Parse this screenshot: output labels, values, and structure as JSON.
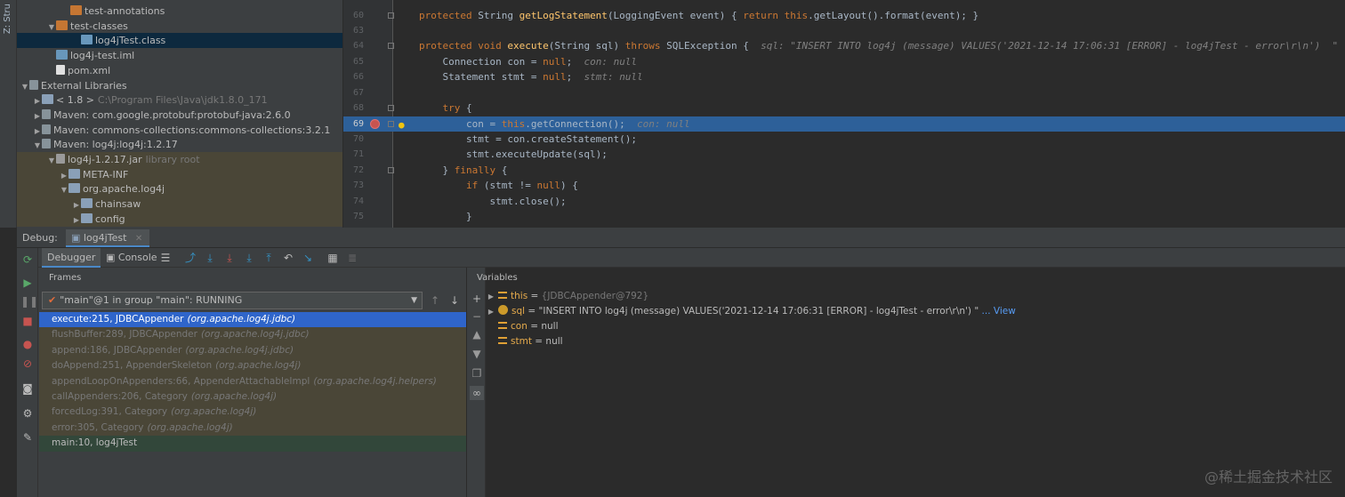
{
  "sidebar": {
    "strip_label": "Z: Stru"
  },
  "project_tree": [
    {
      "indent": 50,
      "arrow": "",
      "icon": "folder",
      "label": "test-annotations",
      "extra": ""
    },
    {
      "indent": 34,
      "arrow": "down",
      "icon": "folder",
      "label": "test-classes",
      "extra": ""
    },
    {
      "indent": 62,
      "arrow": "",
      "icon": "file",
      "label": "log4jTest.class",
      "extra": "",
      "selected": true
    },
    {
      "indent": 34,
      "arrow": "",
      "icon": "file",
      "label": "log4j-test.iml",
      "extra": ""
    },
    {
      "indent": 34,
      "arrow": "",
      "icon": "xml",
      "label": "pom.xml",
      "extra": ""
    },
    {
      "indent": 4,
      "arrow": "down",
      "icon": "lib",
      "label": "External Libraries",
      "extra": ""
    },
    {
      "indent": 18,
      "arrow": "right",
      "icon": "folder-blue",
      "label": "< 1.8 >",
      "extra": "C:\\Program Files\\Java\\jdk1.8.0_171"
    },
    {
      "indent": 18,
      "arrow": "right",
      "icon": "lib",
      "label": "Maven: com.google.protobuf:protobuf-java:2.6.0",
      "extra": ""
    },
    {
      "indent": 18,
      "arrow": "right",
      "icon": "lib",
      "label": "Maven: commons-collections:commons-collections:3.2.1",
      "extra": ""
    },
    {
      "indent": 18,
      "arrow": "down",
      "icon": "lib",
      "label": "Maven: log4j:log4j:1.2.17",
      "extra": ""
    },
    {
      "indent": 34,
      "arrow": "down",
      "icon": "jar",
      "label": "log4j-1.2.17.jar",
      "extra": "library root",
      "lib": true
    },
    {
      "indent": 48,
      "arrow": "right",
      "icon": "folder-blue",
      "label": "META-INF",
      "extra": "",
      "lib": true
    },
    {
      "indent": 48,
      "arrow": "down",
      "icon": "folder-blue",
      "label": "org.apache.log4j",
      "extra": "",
      "lib": true
    },
    {
      "indent": 62,
      "arrow": "right",
      "icon": "folder-blue",
      "label": "chainsaw",
      "extra": "",
      "lib": true
    },
    {
      "indent": 62,
      "arrow": "right",
      "icon": "folder-blue",
      "label": "config",
      "extra": "",
      "lib": true
    }
  ],
  "editor": {
    "lines": [
      {
        "num": "60",
        "segments": [
          [
            "kw",
            "protected "
          ],
          [
            "",
            "String "
          ],
          [
            "fn",
            "getLogStatement"
          ],
          [
            "",
            "(LoggingEvent event) { "
          ],
          [
            "kw",
            "return "
          ],
          [
            "kw",
            "this"
          ],
          [
            "",
            ".getLayout().format(event); }"
          ]
        ]
      },
      {
        "num": "63",
        "segments": []
      },
      {
        "num": "64",
        "segments": [
          [
            "kw",
            "protected void "
          ],
          [
            "fn",
            "execute"
          ],
          [
            "",
            "(String sql) "
          ],
          [
            "kw",
            "throws "
          ],
          [
            "",
            "SQLException {  "
          ],
          [
            "cm",
            "sql: \"INSERT INTO log4j (message) VALUES('2021-12-14 17:06:31 [ERROR] - log4jTest - error\\r\\n')  \""
          ]
        ]
      },
      {
        "num": "65",
        "segments": [
          [
            "",
            "    Connection con = "
          ],
          [
            "kw",
            "null"
          ],
          [
            "",
            ";  "
          ],
          [
            "cm",
            "con: null"
          ]
        ]
      },
      {
        "num": "66",
        "segments": [
          [
            "",
            "    Statement stmt = "
          ],
          [
            "kw",
            "null"
          ],
          [
            "",
            ";  "
          ],
          [
            "cm",
            "stmt: null"
          ]
        ]
      },
      {
        "num": "67",
        "segments": []
      },
      {
        "num": "68",
        "segments": [
          [
            "kw",
            "    try "
          ],
          [
            "",
            "{"
          ]
        ]
      },
      {
        "num": "69",
        "segments": [
          [
            "",
            "        con = "
          ],
          [
            "kw",
            "this"
          ],
          [
            "",
            ".getConnection();  "
          ],
          [
            "cm",
            "con: null"
          ]
        ],
        "highlight": true
      },
      {
        "num": "70",
        "segments": [
          [
            "",
            "        stmt = con.createStatement();"
          ]
        ]
      },
      {
        "num": "71",
        "segments": [
          [
            "",
            "        stmt.executeUpdate(sql);"
          ]
        ]
      },
      {
        "num": "72",
        "segments": [
          [
            "",
            "    } "
          ],
          [
            "kw",
            "finally "
          ],
          [
            "",
            "{"
          ]
        ]
      },
      {
        "num": "73",
        "segments": [
          [
            "kw",
            "        if "
          ],
          [
            "",
            "(stmt != "
          ],
          [
            "kw",
            "null"
          ],
          [
            "",
            ") {"
          ]
        ]
      },
      {
        "num": "74",
        "segments": [
          [
            "",
            "            stmt.close();"
          ]
        ]
      },
      {
        "num": "75",
        "segments": [
          [
            "",
            "        }"
          ]
        ]
      }
    ]
  },
  "debug": {
    "label": "Debug:",
    "tab": "log4jTest",
    "tabs": [
      "Debugger",
      "Console"
    ],
    "frames_title": "Frames",
    "thread": "\"main\"@1 in group \"main\": RUNNING",
    "frames": [
      {
        "method": "execute:215, JDBCAppender",
        "pkg": "(org.apache.log4j.jdbc)",
        "state": "sel"
      },
      {
        "method": "flushBuffer:289, JDBCAppender",
        "pkg": "(org.apache.log4j.jdbc)",
        "state": "lib"
      },
      {
        "method": "append:186, JDBCAppender",
        "pkg": "(org.apache.log4j.jdbc)",
        "state": "lib"
      },
      {
        "method": "doAppend:251, AppenderSkeleton",
        "pkg": "(org.apache.log4j)",
        "state": "lib"
      },
      {
        "method": "appendLoopOnAppenders:66, AppenderAttachableImpl",
        "pkg": "(org.apache.log4j.helpers)",
        "state": "lib"
      },
      {
        "method": "callAppenders:206, Category",
        "pkg": "(org.apache.log4j)",
        "state": "lib"
      },
      {
        "method": "forcedLog:391, Category",
        "pkg": "(org.apache.log4j)",
        "state": "lib"
      },
      {
        "method": "error:305, Category",
        "pkg": "(org.apache.log4j)",
        "state": "lib"
      },
      {
        "method": "main:10, log4jTest",
        "pkg": "",
        "state": "main"
      }
    ],
    "variables_title": "Variables",
    "variables": [
      {
        "name": "this",
        "eq": " = ",
        "value": "{JDBCAppender@792}",
        "kind": "obj",
        "expand": true
      },
      {
        "name": "sql",
        "eq": " = ",
        "value": "\"INSERT INTO log4j (message) VALUES('2021-12-14 17:06:31 [ERROR] - log4jTest - error\\r\\n')  \"",
        "suffix": " ... View",
        "kind": "param",
        "expand": true
      },
      {
        "name": "con",
        "eq": " = ",
        "value": "null",
        "kind": "obj",
        "expand": false
      },
      {
        "name": "stmt",
        "eq": " = ",
        "value": "null",
        "kind": "obj",
        "expand": false
      }
    ]
  },
  "watermark": "@稀土掘金技术社区"
}
